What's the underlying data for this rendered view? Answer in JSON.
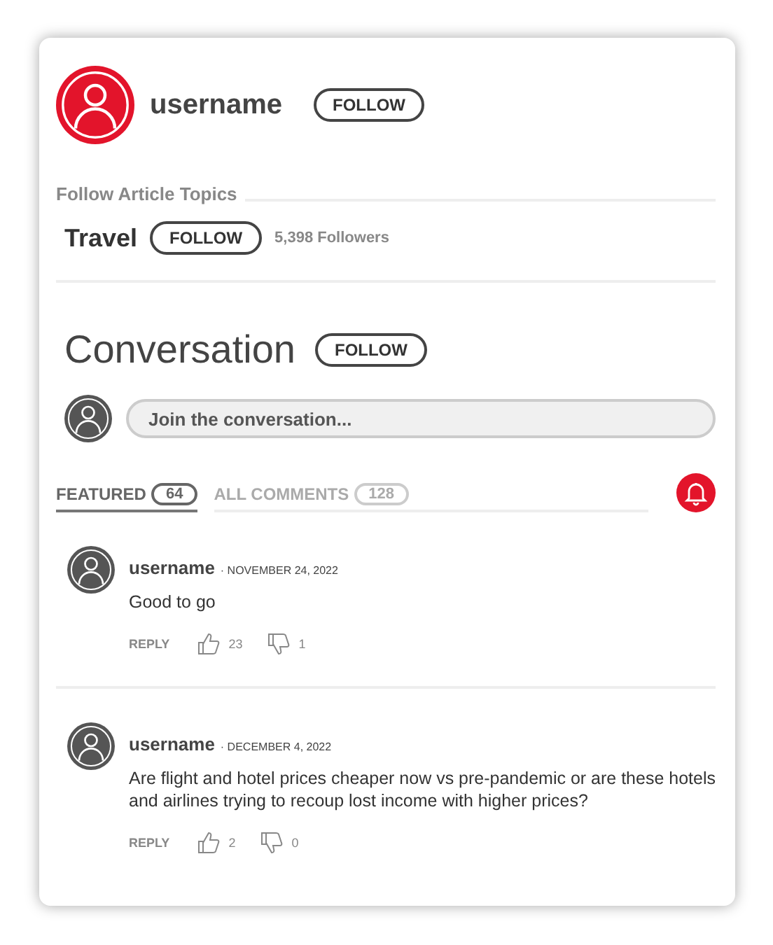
{
  "author": {
    "name": "username",
    "follow": "FOLLOW"
  },
  "topics": {
    "heading": "Follow Article Topics",
    "items": [
      {
        "name": "Travel",
        "follow": "FOLLOW",
        "followers": "5,398 Followers"
      }
    ]
  },
  "conversation": {
    "title": "Conversation",
    "follow": "FOLLOW",
    "placeholder": "Join the conversation..."
  },
  "tabs": [
    {
      "label": "FEATURED",
      "count": "64",
      "selected": true
    },
    {
      "label": "ALL COMMENTS",
      "count": "128",
      "selected": false
    }
  ],
  "comments": [
    {
      "user": "username",
      "date": "· NOVEMBER 24, 2022",
      "text": "Good to go",
      "reply": "REPLY",
      "likes": "23",
      "dislikes": "1"
    },
    {
      "user": "username",
      "date": "· DECEMBER 4, 2022",
      "text": "Are flight and hotel prices cheaper now vs pre-pandemic or are these hotels and airlines trying to recoup lost income with higher prices?",
      "reply": "REPLY",
      "likes": "2",
      "dislikes": "0"
    }
  ]
}
